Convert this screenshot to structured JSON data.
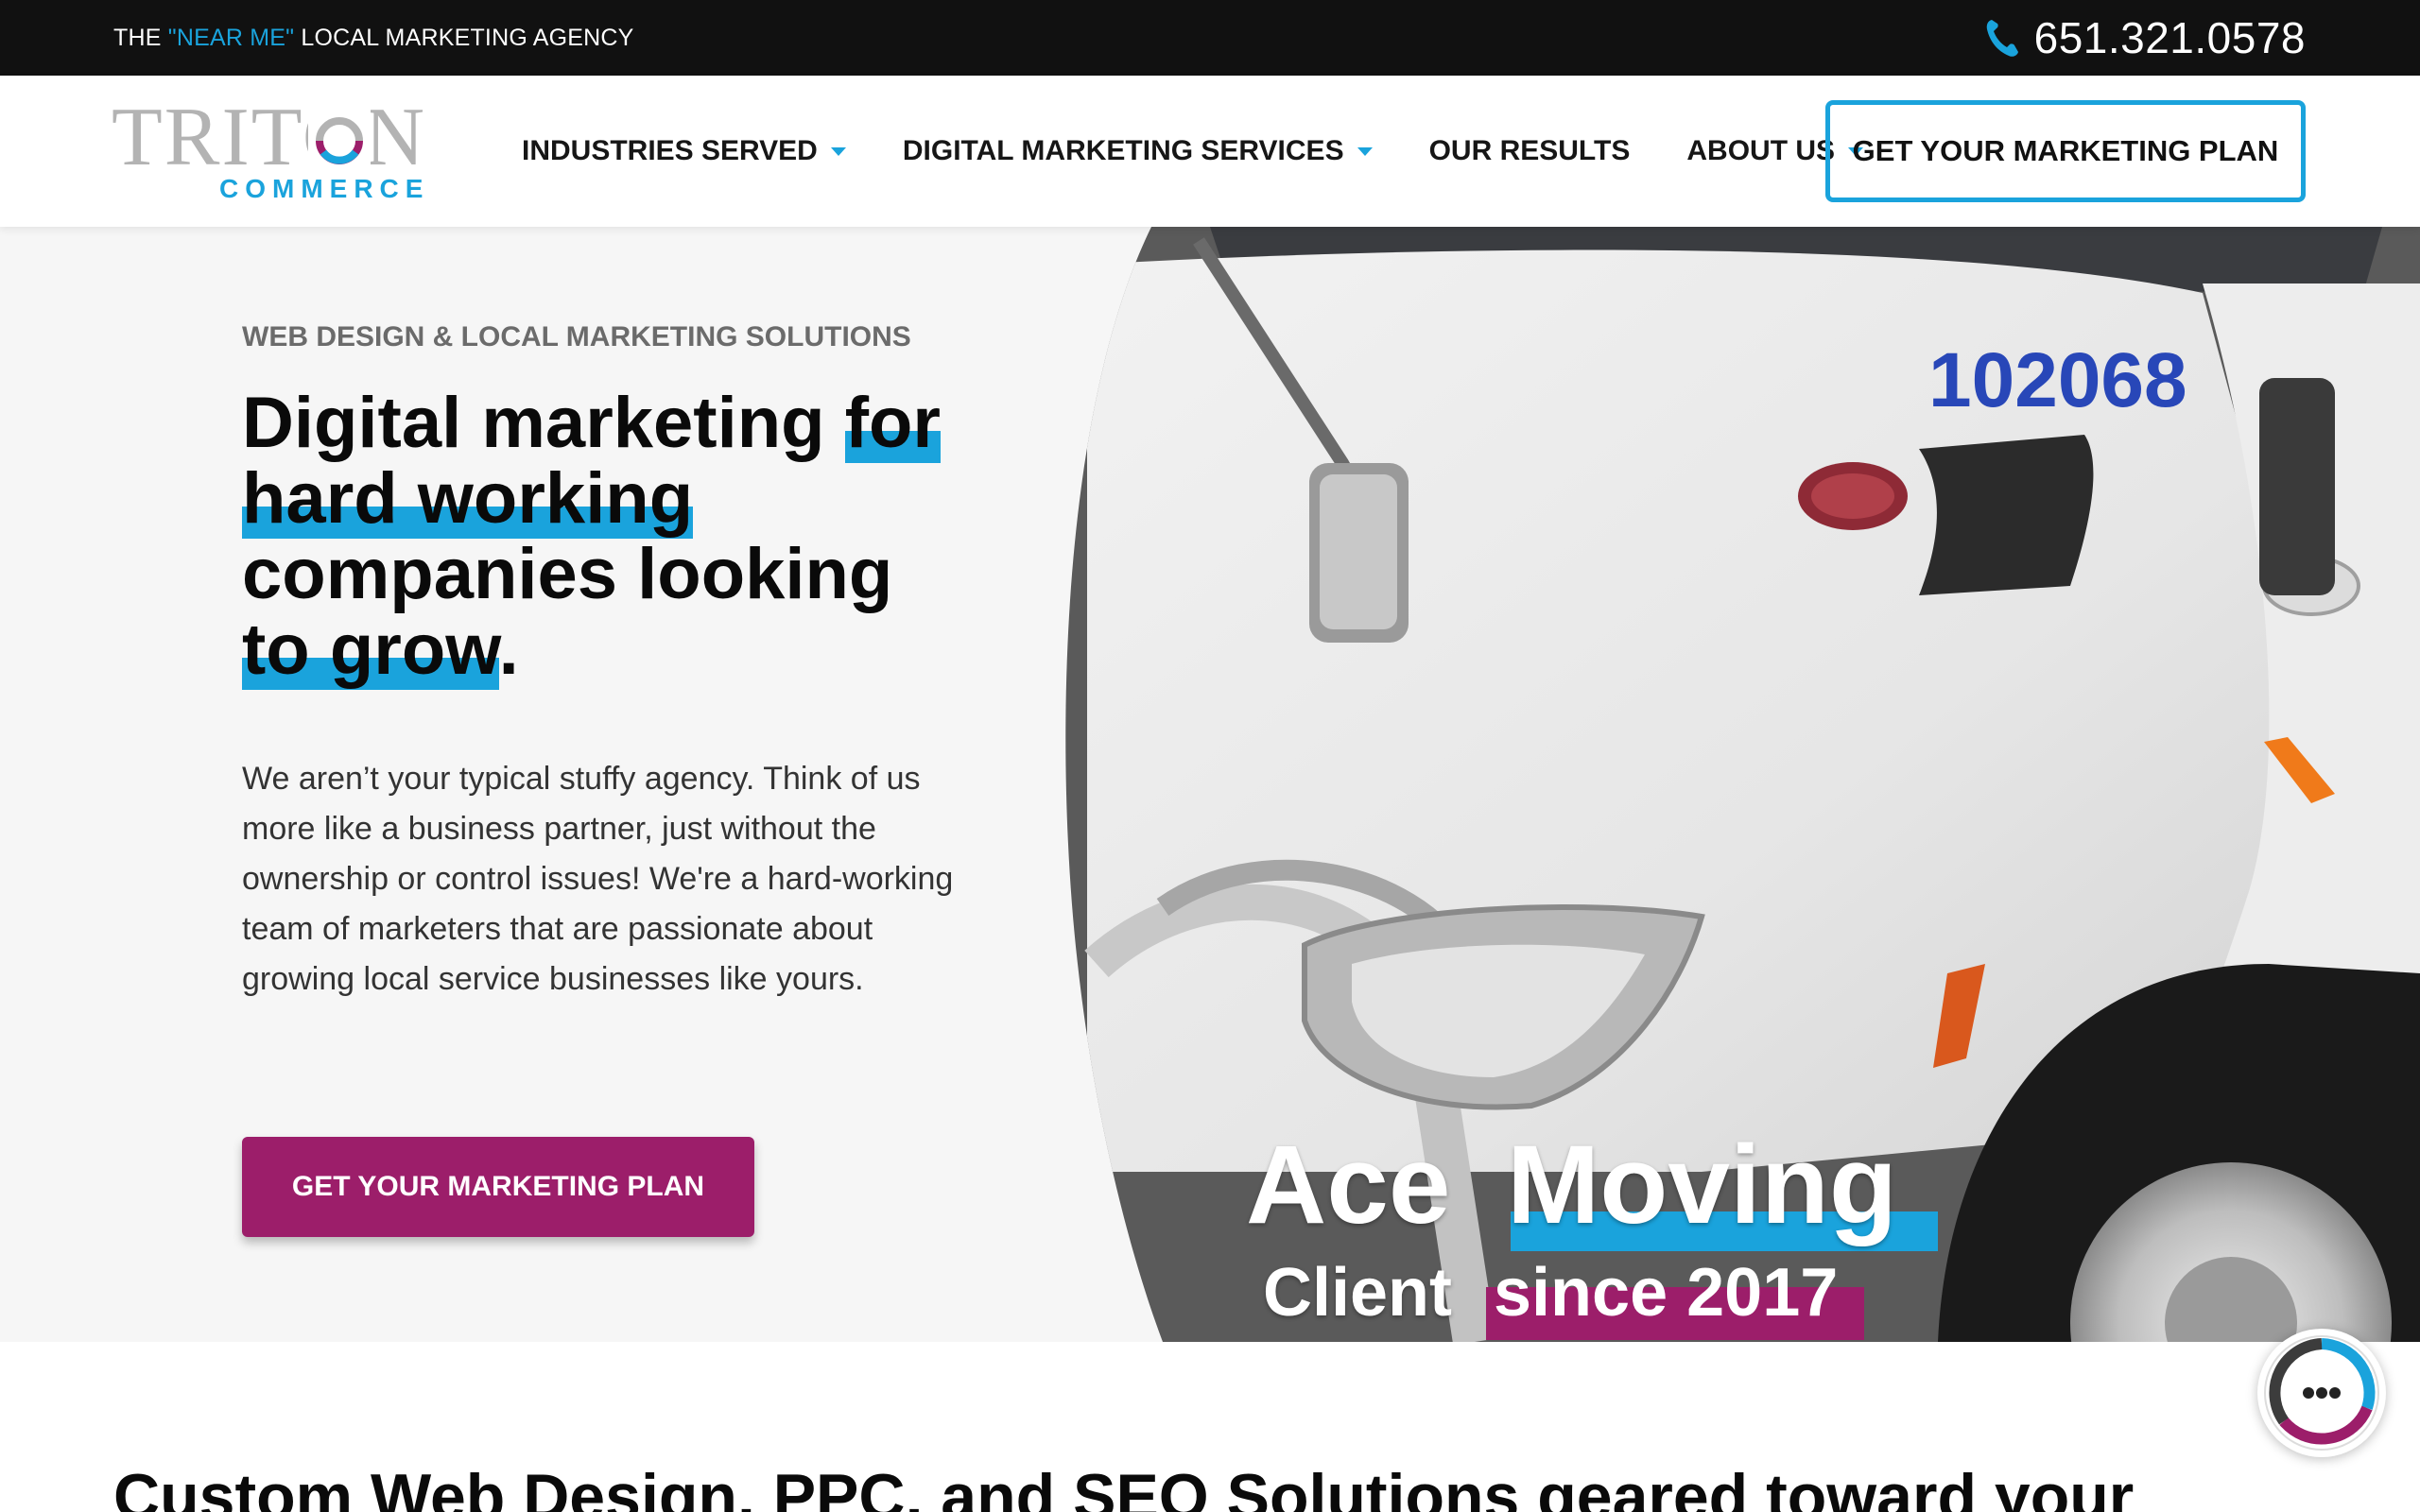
{
  "topbar": {
    "tagline_prefix": "THE ",
    "tagline_accent": "\"NEAR ME\"",
    "tagline_suffix": " LOCAL MARKETING AGENCY",
    "phone": "651.321.0578"
  },
  "logo": {
    "word": "TRITON",
    "subtitle": "COMMERCE"
  },
  "nav": {
    "items": [
      {
        "label": "INDUSTRIES SERVED",
        "icon": "chevron-down-icon"
      },
      {
        "label": "DIGITAL MARKETING SERVICES",
        "icon": "chevron-down-icon"
      },
      {
        "label": "OUR RESULTS"
      },
      {
        "label": "ABOUT US",
        "icon": "chevron-down-icon"
      }
    ],
    "cta": "GET YOUR MARKETING PLAN"
  },
  "hero": {
    "eyebrow": "WEB DESIGN & LOCAL MARKETING SOLUTIONS",
    "title_part1": "Digital marketing ",
    "title_highlight1": "for hard working",
    "title_part2": " companies looking ",
    "title_highlight2": "to grow",
    "title_end": ".",
    "body": "We aren’t your typical stuffy agency. Think of us more like a business partner, just without the ownership or control issues! We're a hard-working team of marketers that are passionate about growing local service businesses like yours.",
    "cta": "GET YOUR MARKETING PLAN"
  },
  "video": {
    "truck_number": "102068",
    "caption_name_1": "Ace",
    "caption_name_2": "Moving",
    "caption_client": "Client",
    "caption_since": "since 2017"
  },
  "section": {
    "heading": "Custom Web Design, PPC, and SEO Solutions geared toward your"
  },
  "colors": {
    "accent_blue": "#1aa3dc",
    "accent_magenta": "#9c1e6a",
    "topbar_bg": "#111111",
    "hero_bg": "#f6f6f6"
  },
  "icons": {
    "phone": "phone-icon",
    "chat": "chat-icon"
  }
}
